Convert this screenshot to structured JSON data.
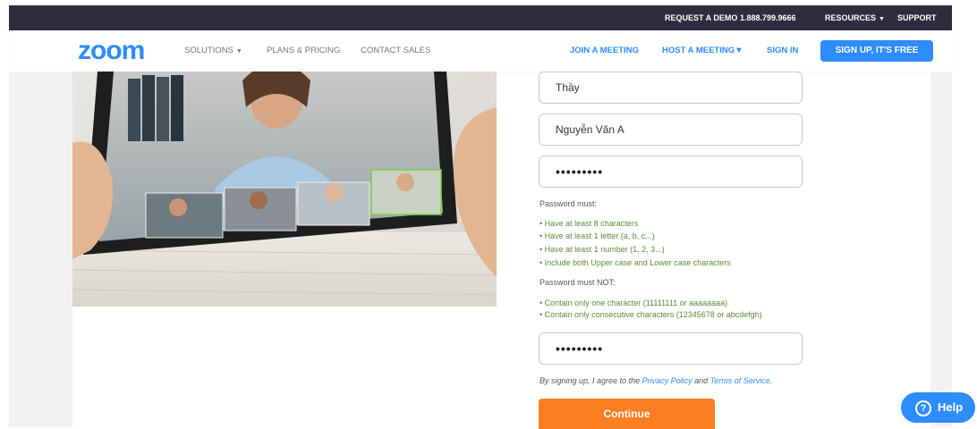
{
  "topbar": {
    "request_demo": "REQUEST A DEMO",
    "phone": "1.888.799.9666",
    "resources": "RESOURCES",
    "support": "SUPPORT"
  },
  "navbar": {
    "logo": "zoom",
    "solutions": "SOLUTIONS",
    "plans": "PLANS & PRICING",
    "contact": "CONTACT SALES",
    "join": "JOIN A MEETING",
    "host": "HOST A MEETING",
    "signin": "SIGN IN",
    "signup": "SIGN UP, IT'S FREE"
  },
  "form": {
    "first_name": "Thầy",
    "last_name": "Nguyễn Văn A",
    "password_mask": "•••••••••",
    "confirm_mask": "•••••••••",
    "password_must_title": "Password must:",
    "password_must": [
      "Have at least 8 characters",
      "Have at least 1 letter (a, b, c...)",
      "Have at least 1 number (1, 2, 3...)",
      "Include both Upper case and Lower case characters"
    ],
    "password_must_not_title": "Password must NOT:",
    "password_must_not": [
      "Contain only one character (11111111 or aaaaaaaa)",
      "Contain only consecutive characters (12345678 or abcdefgh)"
    ],
    "terms_prefix": "By signing up, I agree to the ",
    "privacy": "Privacy Policy",
    "and": " and ",
    "terms_of_service": "Terms of Service",
    "terms_suffix": ".",
    "continue": "Continue"
  },
  "help": {
    "icon": "?",
    "label": "Help"
  },
  "colors": {
    "brand_blue": "#2d8cff",
    "topbar": "#2d2d3f",
    "continue_orange": "#fd7e22",
    "requirement_green": "#5a8a3c"
  },
  "icons": {
    "caret": "chevron-down-icon",
    "help": "question-circle-icon"
  }
}
